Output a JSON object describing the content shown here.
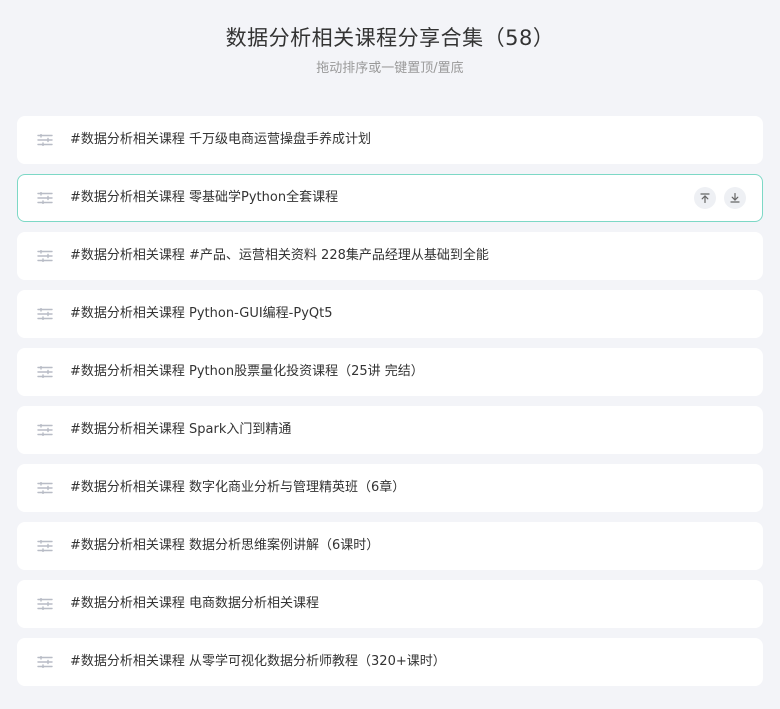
{
  "header": {
    "title": "数据分析相关课程分享合集（58）",
    "subtitle": "拖动排序或一键置顶/置底"
  },
  "items": [
    {
      "label": "#数据分析相关课程 千万级电商运营操盘手养成计划",
      "active": false
    },
    {
      "label": "#数据分析相关课程 零基础学Python全套课程",
      "active": true
    },
    {
      "label": "#数据分析相关课程 #产品、运营相关资料 228集产品经理从基础到全能",
      "active": false
    },
    {
      "label": "#数据分析相关课程 Python-GUI编程-PyQt5",
      "active": false
    },
    {
      "label": "#数据分析相关课程 Python股票量化投资课程（25讲 完结）",
      "active": false
    },
    {
      "label": "#数据分析相关课程 Spark入门到精通",
      "active": false
    },
    {
      "label": "#数据分析相关课程 数字化商业分析与管理精英班（6章）",
      "active": false
    },
    {
      "label": "#数据分析相关课程 数据分析思维案例讲解（6课时）",
      "active": false
    },
    {
      "label": "#数据分析相关课程 电商数据分析相关课程",
      "active": false
    },
    {
      "label": "#数据分析相关课程 从零学可视化数据分析师教程（320+课时）",
      "active": false
    }
  ],
  "icons": {
    "drag": "drag-handle-icon",
    "pin_top": "pin-to-top-icon",
    "pin_bottom": "pin-to-bottom-icon"
  },
  "colors": {
    "active_border": "#7dd8c6",
    "background": "#f3f4f8"
  }
}
